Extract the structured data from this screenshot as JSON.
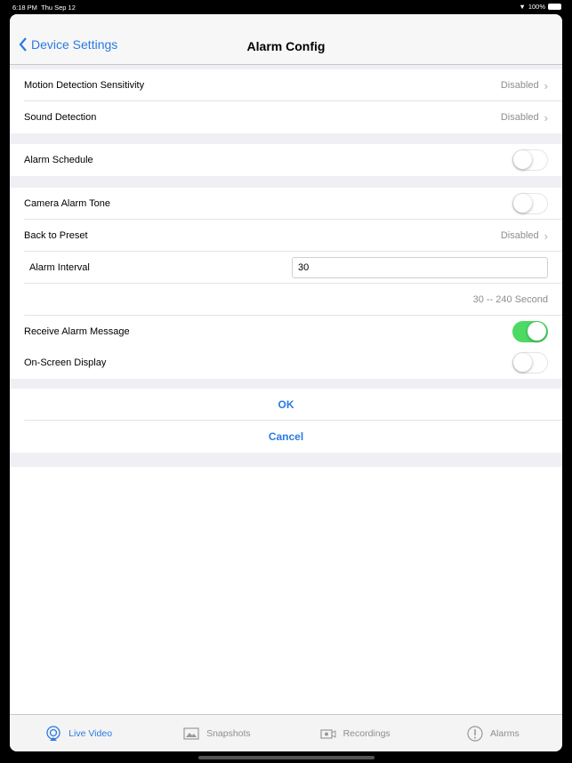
{
  "status": {
    "time": "6:18 PM",
    "date": "Thu Sep 12",
    "battery": "100%"
  },
  "nav": {
    "back_label": "Device Settings",
    "title": "Alarm Config"
  },
  "rows": {
    "motion": {
      "label": "Motion Detection Sensitivity",
      "value": "Disabled"
    },
    "sound": {
      "label": "Sound Detection",
      "value": "Disabled"
    },
    "schedule": {
      "label": "Alarm Schedule",
      "on": false
    },
    "tone": {
      "label": "Camera Alarm Tone",
      "on": false
    },
    "preset": {
      "label": "Back to Preset",
      "value": "Disabled"
    },
    "interval": {
      "label": "Alarm Interval",
      "value": "30",
      "hint": "30 -- 240 Second"
    },
    "receive": {
      "label": "Receive Alarm Message",
      "on": true
    },
    "osd": {
      "label": "On-Screen Display",
      "on": false
    }
  },
  "buttons": {
    "ok": "OK",
    "cancel": "Cancel"
  },
  "tabs": [
    {
      "label": "Live Video",
      "icon": "live-video-icon",
      "active": true
    },
    {
      "label": "Snapshots",
      "icon": "snapshots-icon"
    },
    {
      "label": "Recordings",
      "icon": "recordings-icon"
    },
    {
      "label": "Alarms",
      "icon": "alarms-icon"
    }
  ],
  "colors": {
    "accent": "#2a7ae2",
    "toggle_on": "#4cd964"
  }
}
